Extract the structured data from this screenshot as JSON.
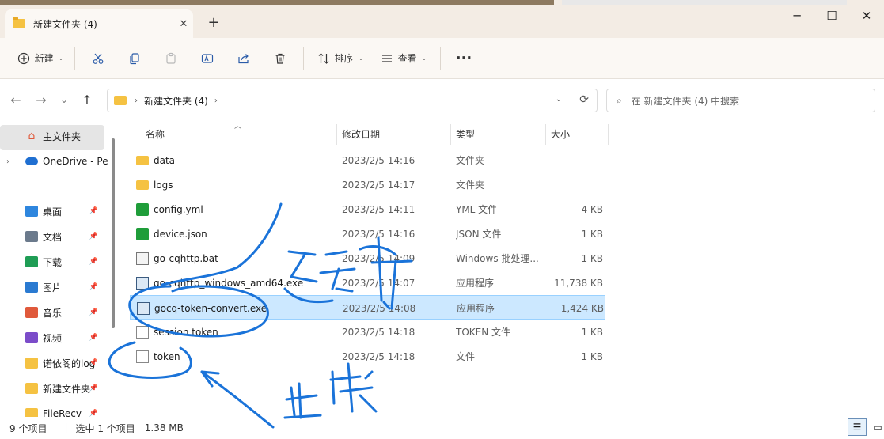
{
  "window": {
    "tab_title": "新建文件夹 (4)",
    "tab_close": "✕",
    "new_tab": "+",
    "minimize": "─",
    "maximize": "☐",
    "close": "✕"
  },
  "toolbar": {
    "new_label": "新建",
    "sort_label": "排序",
    "view_label": "查看",
    "more_label": "···",
    "icons": [
      "cut-icon",
      "copy-icon",
      "paste-icon",
      "rename-icon",
      "share-icon",
      "delete-icon"
    ]
  },
  "address": {
    "back": "←",
    "forward": "→",
    "recent": "⌄",
    "up": "↑",
    "crumb": "新建文件夹 (4)",
    "crumb_sep": "›",
    "search_placeholder": "在 新建文件夹 (4) 中搜索"
  },
  "sidebar": {
    "home": "主文件夹",
    "onedrive": "OneDrive - Pe",
    "items": [
      {
        "label": "桌面",
        "icon": "desktop-icon",
        "color": "#2e86de"
      },
      {
        "label": "文档",
        "icon": "documents-icon",
        "color": "#6b7a8c"
      },
      {
        "label": "下载",
        "icon": "downloads-icon",
        "color": "#1f9d55"
      },
      {
        "label": "图片",
        "icon": "pictures-icon",
        "color": "#2a7ad1"
      },
      {
        "label": "音乐",
        "icon": "music-icon",
        "color": "#e0593b"
      },
      {
        "label": "视频",
        "icon": "videos-icon",
        "color": "#7b4cc9"
      },
      {
        "label": "诺依阁的log",
        "icon": "folder-icon",
        "color": "#f5c242"
      },
      {
        "label": "新建文件夹",
        "icon": "folder-icon",
        "color": "#f5c242"
      },
      {
        "label": "FileRecv",
        "icon": "folder-icon",
        "color": "#f5c242"
      }
    ]
  },
  "columns": {
    "name": "名称",
    "date": "修改日期",
    "type": "类型",
    "size": "大小"
  },
  "files": [
    {
      "name": "data",
      "date": "2023/2/5 14:16",
      "type": "文件夹",
      "size": "",
      "icon": "folder"
    },
    {
      "name": "logs",
      "date": "2023/2/5 14:17",
      "type": "文件夹",
      "size": "",
      "icon": "folder"
    },
    {
      "name": "config.yml",
      "date": "2023/2/5 14:11",
      "type": "YML 文件",
      "size": "4 KB",
      "icon": "yml"
    },
    {
      "name": "device.json",
      "date": "2023/2/5 14:16",
      "type": "JSON 文件",
      "size": "1 KB",
      "icon": "yml"
    },
    {
      "name": "go-cqhttp.bat",
      "date": "2023/2/5 14:09",
      "type": "Windows 批处理...",
      "size": "1 KB",
      "icon": "bat"
    },
    {
      "name": "go-cqhttp_windows_amd64.exe",
      "date": "2023/2/5 14:07",
      "type": "应用程序",
      "size": "11,738 KB",
      "icon": "exe"
    },
    {
      "name": "gocq-token-convert.exe",
      "date": "2023/2/5 14:08",
      "type": "应用程序",
      "size": "1,424 KB",
      "icon": "exe"
    },
    {
      "name": "session.token",
      "date": "2023/2/5 14:18",
      "type": "TOKEN 文件",
      "size": "1 KB",
      "icon": "doc"
    },
    {
      "name": "token",
      "date": "2023/2/5 14:18",
      "type": "文件",
      "size": "1 KB",
      "icon": "doc"
    }
  ],
  "selected_index": 6,
  "status": {
    "count": "9 个项目",
    "selected": "选中 1 个项目",
    "size": "1.38 MB"
  },
  "annotations": {
    "run_text": "运行",
    "generate_text": "生成",
    "ink_color": "#1a73d9"
  }
}
